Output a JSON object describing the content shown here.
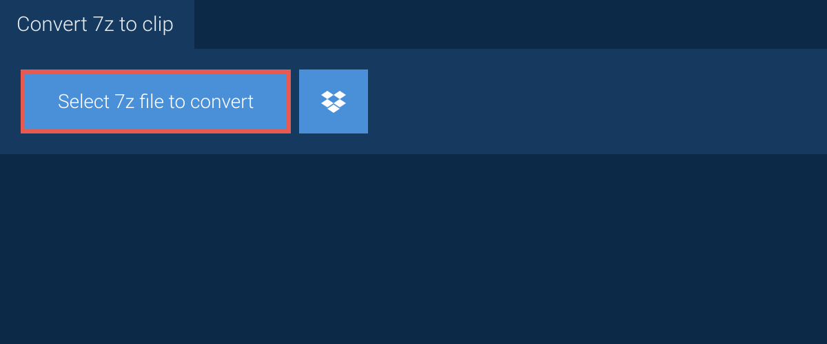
{
  "tab": {
    "title": "Convert 7z to clip"
  },
  "actions": {
    "select_file_label": "Select 7z file to convert"
  }
}
